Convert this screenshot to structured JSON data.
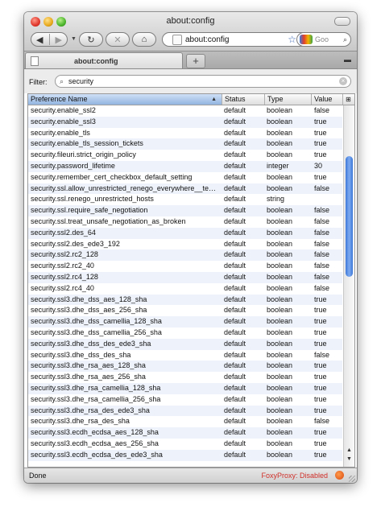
{
  "window": {
    "title": "about:config"
  },
  "toolbar": {
    "url": "about:config",
    "search_placeholder": "Goo"
  },
  "tabs": [
    {
      "label": "about:config"
    }
  ],
  "filter": {
    "label": "Filter:",
    "value": "security"
  },
  "columns": {
    "name": "Preference Name",
    "status": "Status",
    "type": "Type",
    "value": "Value"
  },
  "rows": [
    {
      "name": "security.enable_ssl2",
      "status": "default",
      "type": "boolean",
      "value": "false"
    },
    {
      "name": "security.enable_ssl3",
      "status": "default",
      "type": "boolean",
      "value": "true"
    },
    {
      "name": "security.enable_tls",
      "status": "default",
      "type": "boolean",
      "value": "true"
    },
    {
      "name": "security.enable_tls_session_tickets",
      "status": "default",
      "type": "boolean",
      "value": "true"
    },
    {
      "name": "security.fileuri.strict_origin_policy",
      "status": "default",
      "type": "boolean",
      "value": "true"
    },
    {
      "name": "security.password_lifetime",
      "status": "default",
      "type": "integer",
      "value": "30"
    },
    {
      "name": "security.remember_cert_checkbox_default_setting",
      "status": "default",
      "type": "boolean",
      "value": "true"
    },
    {
      "name": "security.ssl.allow_unrestricted_renego_everywhere__temporarily_available_pref",
      "status": "default",
      "type": "boolean",
      "value": "false"
    },
    {
      "name": "security.ssl.renego_unrestricted_hosts",
      "status": "default",
      "type": "string",
      "value": ""
    },
    {
      "name": "security.ssl.require_safe_negotiation",
      "status": "default",
      "type": "boolean",
      "value": "false"
    },
    {
      "name": "security.ssl.treat_unsafe_negotiation_as_broken",
      "status": "default",
      "type": "boolean",
      "value": "false"
    },
    {
      "name": "security.ssl2.des_64",
      "status": "default",
      "type": "boolean",
      "value": "false"
    },
    {
      "name": "security.ssl2.des_ede3_192",
      "status": "default",
      "type": "boolean",
      "value": "false"
    },
    {
      "name": "security.ssl2.rc2_128",
      "status": "default",
      "type": "boolean",
      "value": "false"
    },
    {
      "name": "security.ssl2.rc2_40",
      "status": "default",
      "type": "boolean",
      "value": "false"
    },
    {
      "name": "security.ssl2.rc4_128",
      "status": "default",
      "type": "boolean",
      "value": "false"
    },
    {
      "name": "security.ssl2.rc4_40",
      "status": "default",
      "type": "boolean",
      "value": "false"
    },
    {
      "name": "security.ssl3.dhe_dss_aes_128_sha",
      "status": "default",
      "type": "boolean",
      "value": "true"
    },
    {
      "name": "security.ssl3.dhe_dss_aes_256_sha",
      "status": "default",
      "type": "boolean",
      "value": "true"
    },
    {
      "name": "security.ssl3.dhe_dss_camellia_128_sha",
      "status": "default",
      "type": "boolean",
      "value": "true"
    },
    {
      "name": "security.ssl3.dhe_dss_camellia_256_sha",
      "status": "default",
      "type": "boolean",
      "value": "true"
    },
    {
      "name": "security.ssl3.dhe_dss_des_ede3_sha",
      "status": "default",
      "type": "boolean",
      "value": "true"
    },
    {
      "name": "security.ssl3.dhe_dss_des_sha",
      "status": "default",
      "type": "boolean",
      "value": "false"
    },
    {
      "name": "security.ssl3.dhe_rsa_aes_128_sha",
      "status": "default",
      "type": "boolean",
      "value": "true"
    },
    {
      "name": "security.ssl3.dhe_rsa_aes_256_sha",
      "status": "default",
      "type": "boolean",
      "value": "true"
    },
    {
      "name": "security.ssl3.dhe_rsa_camellia_128_sha",
      "status": "default",
      "type": "boolean",
      "value": "true"
    },
    {
      "name": "security.ssl3.dhe_rsa_camellia_256_sha",
      "status": "default",
      "type": "boolean",
      "value": "true"
    },
    {
      "name": "security.ssl3.dhe_rsa_des_ede3_sha",
      "status": "default",
      "type": "boolean",
      "value": "true"
    },
    {
      "name": "security.ssl3.dhe_rsa_des_sha",
      "status": "default",
      "type": "boolean",
      "value": "false"
    },
    {
      "name": "security.ssl3.ecdh_ecdsa_aes_128_sha",
      "status": "default",
      "type": "boolean",
      "value": "true"
    },
    {
      "name": "security.ssl3.ecdh_ecdsa_aes_256_sha",
      "status": "default",
      "type": "boolean",
      "value": "true"
    },
    {
      "name": "security.ssl3.ecdh_ecdsa_des_ede3_sha",
      "status": "default",
      "type": "boolean",
      "value": "true"
    }
  ],
  "status": {
    "text": "Done",
    "foxyproxy": "FoxyProxy: Disabled"
  },
  "icons": {
    "back": "back-arrow-icon",
    "forward": "forward-arrow-icon",
    "reload": "reload-icon",
    "stop": "stop-icon",
    "home": "home-icon",
    "bookmark": "star-icon"
  }
}
